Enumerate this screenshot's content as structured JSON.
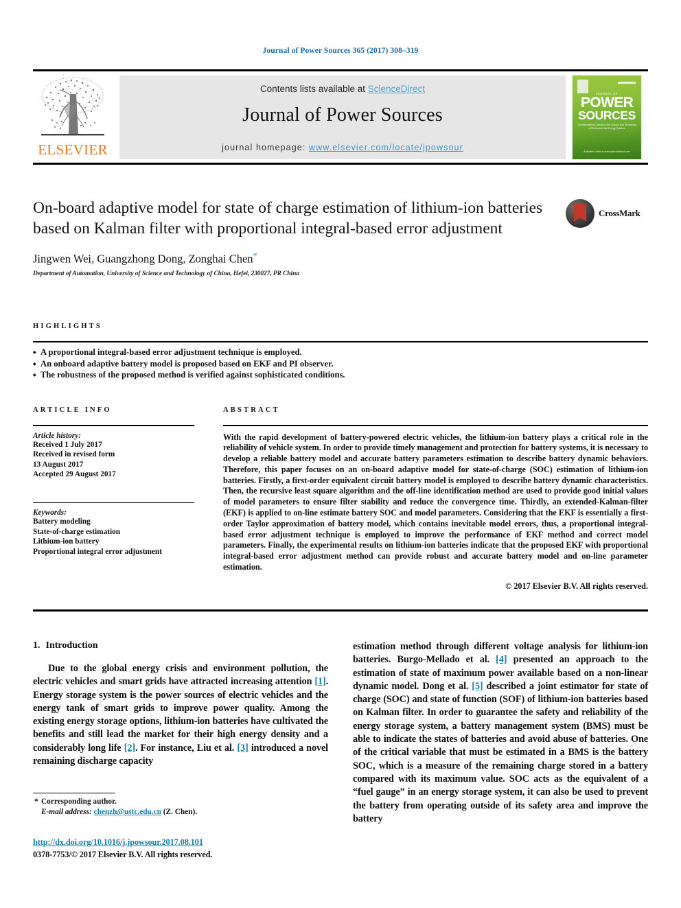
{
  "running_head": "Journal of Power Sources 365 (2017) 308–319",
  "masthead": {
    "contents_prefix": "Contents lists available at ",
    "sciencedirect": "ScienceDirect",
    "journal_title": "Journal of Power Sources",
    "homepage_prefix": "journal homepage: ",
    "homepage_url": "www.elsevier.com/locate/jpowsour",
    "publisher_wordmark": "ELSEVIER",
    "publisher_logo_icon": "elsevier-tree-icon",
    "accent_blue": "#4ea3cc",
    "publisher_orange": "#E87722"
  },
  "cover": {
    "kicker": "JOURNAL OF",
    "word_power": "POWER",
    "word_sources": "SOURCES",
    "subline": "The International Journal on the Science and Technology of Electrochemical Energy Systems",
    "bottom_note": "Available online at\nwww.sciencedirect.com",
    "green": "#6fae2f"
  },
  "article": {
    "title": "On-board adaptive model for state of charge estimation of lithium-ion batteries based on Kalman filter with proportional integral-based error adjustment",
    "authors": "Jingwen Wei, Guangzhong Dong, Zonghai Chen",
    "corresponding_marker": "*",
    "affiliation": "Department of Automation, University of Science and Technology of China, Hefei, 230027, PR China"
  },
  "crossmark": {
    "label": "CrossMark",
    "icon": "crossmark-icon"
  },
  "highlights": {
    "heading": "HIGHLIGHTS",
    "items": [
      "A proportional integral-based error adjustment technique is employed.",
      "An onboard adaptive battery model is proposed based on EKF and PI observer.",
      "The robustness of the proposed method is verified against sophisticated conditions."
    ]
  },
  "article_info": {
    "heading": "ARTICLE INFO",
    "history_label": "Article history:",
    "history": [
      "Received 1 July 2017",
      "Received in revised form",
      "13 August 2017",
      "Accepted 29 August 2017"
    ],
    "keywords_label": "Keywords:",
    "keywords": [
      "Battery modeling",
      "State-of-charge estimation",
      "Lithium-ion battery",
      "Proportional integral error adjustment"
    ]
  },
  "abstract": {
    "heading": "ABSTRACT",
    "text": "With the rapid development of battery-powered electric vehicles, the lithium-ion battery plays a critical role in the reliability of vehicle system. In order to provide timely management and protection for battery systems, it is necessary to develop a reliable battery model and accurate battery parameters estimation to describe battery dynamic behaviors. Therefore, this paper focuses on an on-board adaptive model for state-of-charge (SOC) estimation of lithium-ion batteries. Firstly, a first-order equivalent circuit battery model is employed to describe battery dynamic characteristics. Then, the recursive least square algorithm and the off-line identification method are used to provide good initial values of model parameters to ensure filter stability and reduce the convergence time. Thirdly, an extended-Kalman-filter (EKF) is applied to on-line estimate battery SOC and model parameters. Considering that the EKF is essentially a first-order Taylor approximation of battery model, which contains inevitable model errors, thus, a proportional integral-based error adjustment technique is employed to improve the performance of EKF method and correct model parameters. Finally, the experimental results on lithium-ion batteries indicate that the proposed EKF with proportional integral-based error adjustment method can provide robust and accurate battery model and on-line parameter estimation.",
    "copyright": "© 2017 Elsevier B.V. All rights reserved."
  },
  "introduction": {
    "number": "1.",
    "heading": "Introduction",
    "left_paragraph_a": "Due to the global energy crisis and environment pollution, the electric vehicles and smart grids have attracted increasing attention ",
    "left_ref_1": "[1]",
    "left_paragraph_b": ". Energy storage system is the power sources of electric vehicles and the energy tank of smart grids to improve power quality. Among the existing energy storage options, lithium-ion batteries have cultivated the benefits and still lead the market for their high energy density and a considerably long life ",
    "left_ref_2": "[2]",
    "left_paragraph_c": ". For instance, Liu et al. ",
    "left_ref_3": "[3]",
    "left_paragraph_d": " introduced a novel remaining discharge capacity",
    "right_paragraph_a": "estimation method through different voltage analysis for lithium-ion batteries. Burgo-Mellado et al. ",
    "right_ref_4": "[4]",
    "right_paragraph_b": " presented an approach to the estimation of state of maximum power available based on a non-linear dynamic model. Dong et al. ",
    "right_ref_5": "[5]",
    "right_paragraph_c": " described a joint estimator for state of charge (SOC) and state of function (SOF) of lithium-ion batteries based on Kalman filter. In order to guarantee the safety and reliability of the energy storage system, a battery management system (BMS) must be able to indicate the states of batteries and avoid abuse of batteries. One of the critical variable that must be estimated in a BMS is the battery SOC, which is a measure of the remaining charge stored in a battery compared with its maximum value. SOC acts as the equivalent of a “fuel gauge” in an energy storage system, it can also be used to prevent the battery from operating outside of its safety area and improve the battery"
  },
  "footer": {
    "corresponding_star": "*",
    "corresponding_label": "Corresponding author.",
    "email_label": "E-mail address:",
    "email": "chenzh@ustc.edu.cn",
    "email_suffix": "(Z. Chen).",
    "doi": "http://dx.doi.org/10.1016/j.jpowsour.2017.08.101",
    "issn_line": "0378-7753/© 2017 Elsevier B.V. All rights reserved.",
    "link_blue": "#1b7fa8"
  }
}
